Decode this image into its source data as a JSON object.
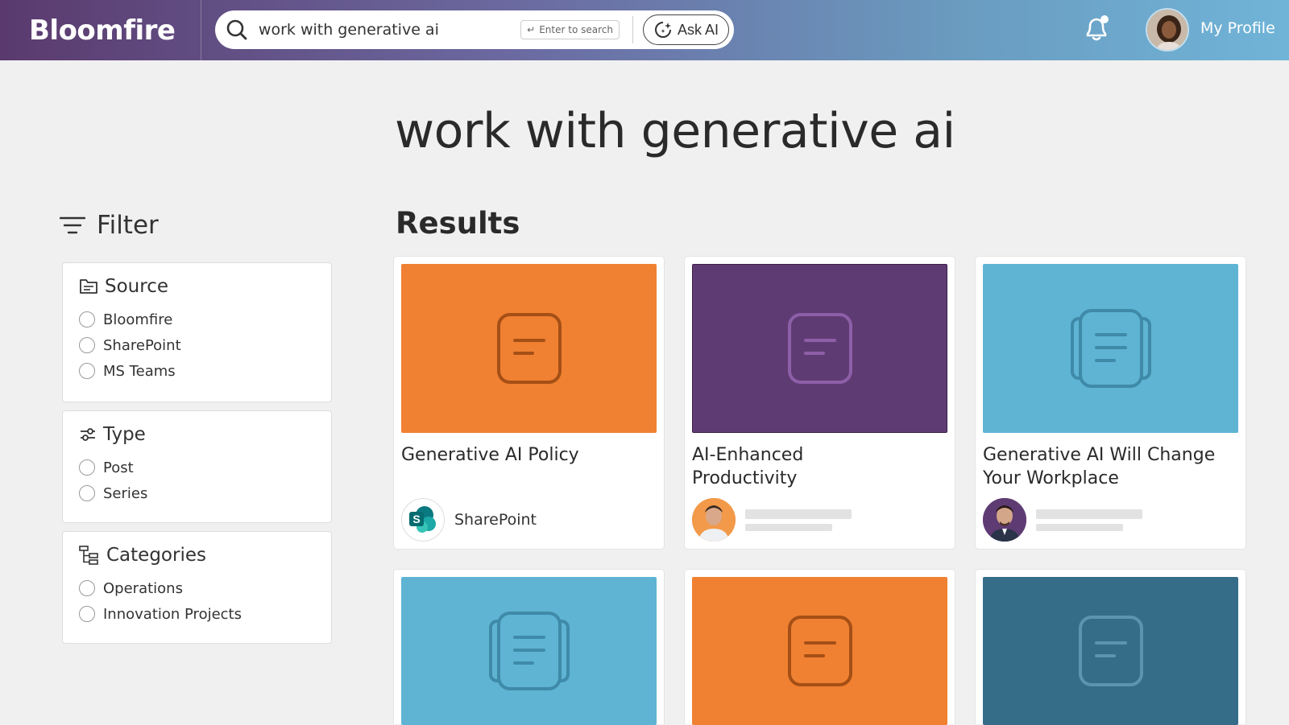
{
  "header": {
    "logo": "Bloomfire",
    "search_value": "work with generative ai",
    "enter_hint": "Enter to search",
    "ask_ai_label": "Ask AI",
    "profile_label": "My Profile"
  },
  "page": {
    "heading": "work with generative ai"
  },
  "filter": {
    "title": "Filter",
    "groups": [
      {
        "title": "Source",
        "options": [
          "Bloomfire",
          "SharePoint",
          "MS Teams"
        ]
      },
      {
        "title": "Type",
        "options": [
          "Post",
          "Series"
        ]
      },
      {
        "title": "Categories",
        "options": [
          "Operations",
          "Innovation Projects"
        ]
      }
    ]
  },
  "results": {
    "title": "Results",
    "cards": [
      {
        "title": "Generative AI Policy",
        "color": "#f08132",
        "source": "SharePoint"
      },
      {
        "title": "AI-Enhanced Productivity",
        "color": "#5f3b73",
        "source": ""
      },
      {
        "title": "Generative AI Will Change Your Workplace",
        "color": "#5fb4d4",
        "source": ""
      },
      {
        "title": "",
        "color": "#5fb4d4",
        "source": ""
      },
      {
        "title": "",
        "color": "#f08132",
        "source": ""
      },
      {
        "title": "",
        "color": "#356c88",
        "source": ""
      }
    ]
  },
  "colors": {
    "orange": "#f08132",
    "purple": "#5f3b73",
    "sky": "#5fb4d4",
    "teal": "#356c88"
  }
}
